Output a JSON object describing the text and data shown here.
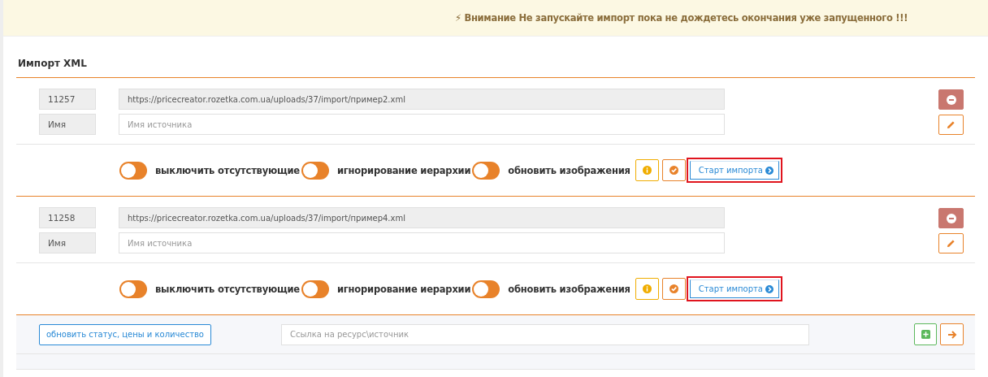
{
  "alert": {
    "icon": "⚡",
    "text": "Внимание Не запускайте импорт пока не дождетесь окончания уже запущенного !!!"
  },
  "panel": {
    "title": "Импорт XML",
    "sources": [
      {
        "id": "11257",
        "url": "https://pricecreator.rozetka.com.ua/uploads/37/import/пример2.xml",
        "name_label": "Имя",
        "name_placeholder": "Имя источника",
        "options": [
          {
            "label": "выключить отсутствующие",
            "on": false
          },
          {
            "label": "игнорирование иерархии",
            "on": false
          },
          {
            "label": "обновить изображения",
            "on": false
          }
        ],
        "start_button": {
          "label": "Старт импорта",
          "highlighted": true
        }
      },
      {
        "id": "11258",
        "url": "https://pricecreator.rozetka.com.ua/uploads/37/import/пример4.xml",
        "name_label": "Имя",
        "name_placeholder": "Имя источника",
        "options": [
          {
            "label": "выключить отсутствующие",
            "on": false
          },
          {
            "label": "игнорирование иерархии",
            "on": false
          },
          {
            "label": "обновить изображения",
            "on": false
          }
        ],
        "start_button": {
          "label": "Старт импорта",
          "highlighted": true
        }
      }
    ],
    "footer": {
      "update_button": "обновить статус, цены и количество",
      "link_placeholder": "Ссылка на ресурс\\источник"
    }
  }
}
